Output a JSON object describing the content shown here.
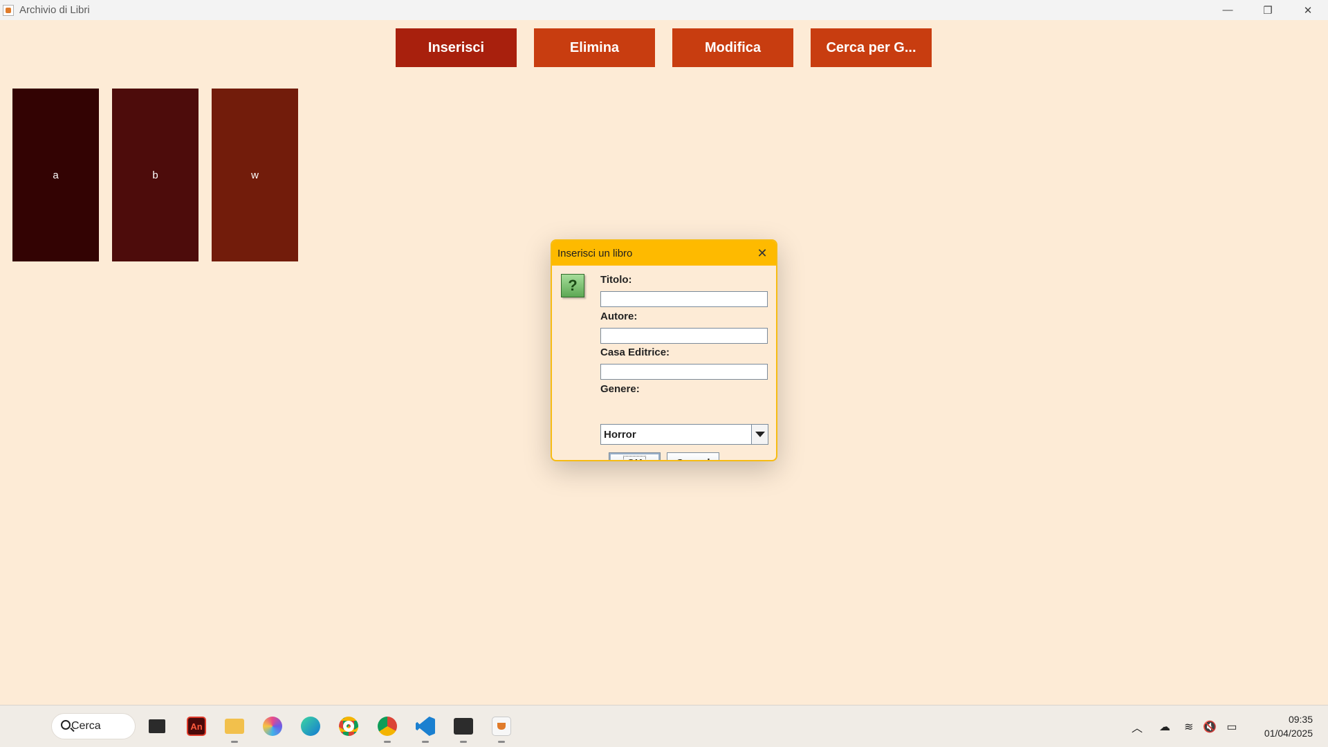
{
  "window": {
    "title": "Archivio di Libri",
    "controls": {
      "minimize": "—",
      "restore": "❐",
      "close": "✕"
    }
  },
  "toolbar": {
    "insert_label": "Inserisci",
    "delete_label": "Elimina",
    "edit_label": "Modifica",
    "search_genre_label": "Cerca per G..."
  },
  "books": [
    {
      "label": "a",
      "color": "#330303"
    },
    {
      "label": "b",
      "color": "#4d0c0b"
    },
    {
      "label": "w",
      "color": "#721c0b"
    }
  ],
  "dialog": {
    "title": "Inserisci un libro",
    "close_glyph": "✕",
    "question_glyph": "?",
    "fields": {
      "title_label": "Titolo:",
      "title_value": "",
      "author_label": "Autore:",
      "author_value": "",
      "publisher_label": "Casa Editrice:",
      "publisher_value": "",
      "genre_label": "Genere:",
      "genre_selected": "Horror"
    },
    "ok_label": "OK",
    "cancel_label": "Cancel"
  },
  "taskbar": {
    "search_label": "Cerca",
    "apps": [
      "windows-start-icon",
      "task-view-icon",
      "adobe-animate-icon",
      "file-explorer-icon",
      "color-picker-icon",
      "edge-icon",
      "chrome-icon",
      "chrome-profile-icon",
      "vscode-icon",
      "terminal-icon",
      "java-icon"
    ],
    "clock_time": "09:35",
    "clock_date": "01/04/2025"
  },
  "colors": {
    "background": "#fdebd6",
    "insert_button": "#a8200d",
    "action_button": "#c83d10",
    "dialog_header": "#feba00"
  }
}
